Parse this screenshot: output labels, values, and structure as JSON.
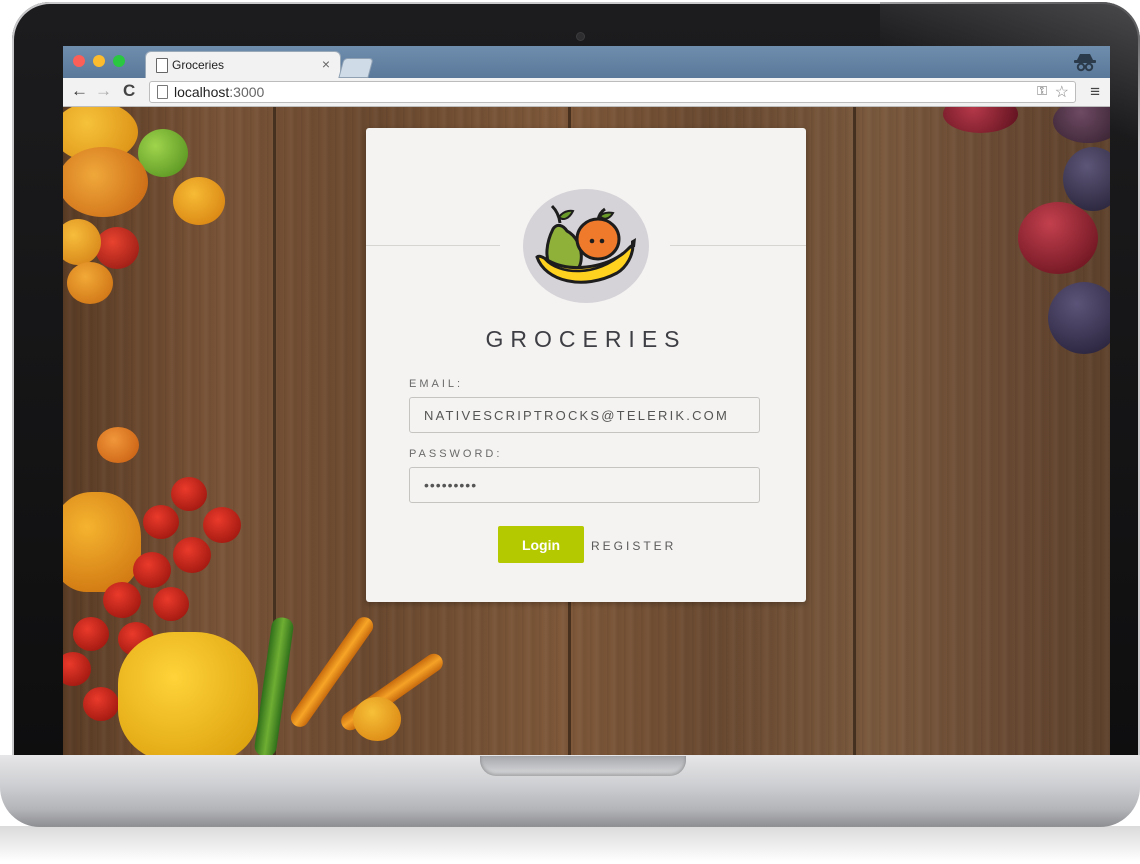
{
  "browser": {
    "tab_title": "Groceries",
    "tab_close": "×",
    "url_host": "localhost",
    "url_port": ":3000",
    "nav_back": "←",
    "nav_forward": "→",
    "nav_reload": "C",
    "menu_glyph": "≡",
    "key_glyph": "⚿",
    "star_glyph": "☆"
  },
  "login": {
    "app_title": "GROCERIES",
    "email_label": "EMAIL:",
    "email_value": "NATIVESCRIPTROCKS@TELERIK.COM",
    "password_label": "PASSWORD:",
    "password_value": "•••••••••",
    "login_button": "Login",
    "register_link": "REGISTER"
  },
  "colors": {
    "accent": "#b5c900",
    "card_bg": "#f4f3f1",
    "titlebar": "#5a7899"
  }
}
